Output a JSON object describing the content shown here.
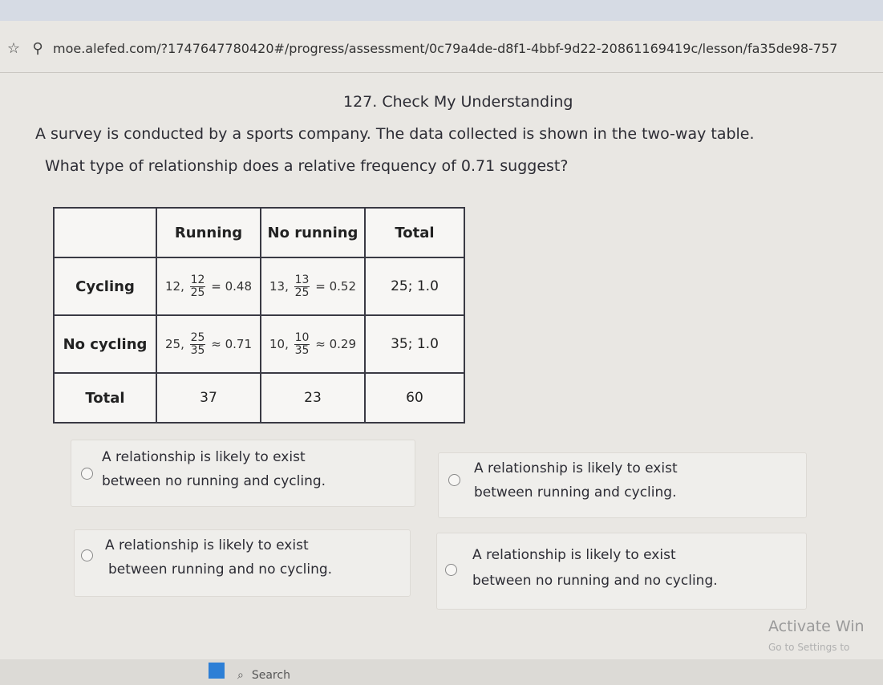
{
  "browser": {
    "url": "moe.alefed.com/?1747647780420#/progress/assessment/0c79a4de-d8f1-4bbf-9d22-20861169419c/lesson/fa35de98-757",
    "star_icon": "star-icon",
    "search_icon": "search-icon"
  },
  "page": {
    "title": "127. Check My Understanding",
    "question_line1": "A survey is conducted by a sports company. The data collected is shown in the two-way table.",
    "question_line2": "What type of relationship does a relative frequency of 0.71 suggest?"
  },
  "table": {
    "headers": [
      "",
      "Running",
      "No running",
      "Total"
    ],
    "rows": [
      {
        "label": "Cycling",
        "c1": {
          "count": "12,",
          "num": "12",
          "den": "25",
          "result": "= 0.48"
        },
        "c2": {
          "count": "13,",
          "num": "13",
          "den": "25",
          "result": "= 0.52"
        },
        "total": "25; 1.0"
      },
      {
        "label": "No cycling",
        "c1": {
          "count": "25,",
          "num": "25",
          "den": "35",
          "result": "≈ 0.71"
        },
        "c2": {
          "count": "10,",
          "num": "10",
          "den": "35",
          "result": "≈ 0.29"
        },
        "total": "35; 1.0"
      }
    ],
    "total_row": {
      "label": "Total",
      "c1": "37",
      "c2": "23",
      "total": "60"
    }
  },
  "options": [
    {
      "line1": "A relationship is likely to exist",
      "line2": "between no running and cycling."
    },
    {
      "line1": "A relationship is likely to exist",
      "line2": "between running and cycling."
    },
    {
      "line1": "A relationship is likely to exist",
      "line2": "between running and no cycling."
    },
    {
      "line1": "A relationship is likely to exist",
      "line2": "between no running and no cycling."
    }
  ],
  "watermark": {
    "line1": "Activate Win",
    "line2": "Go to Settings to"
  },
  "taskbar": {
    "search_label": "Search"
  }
}
